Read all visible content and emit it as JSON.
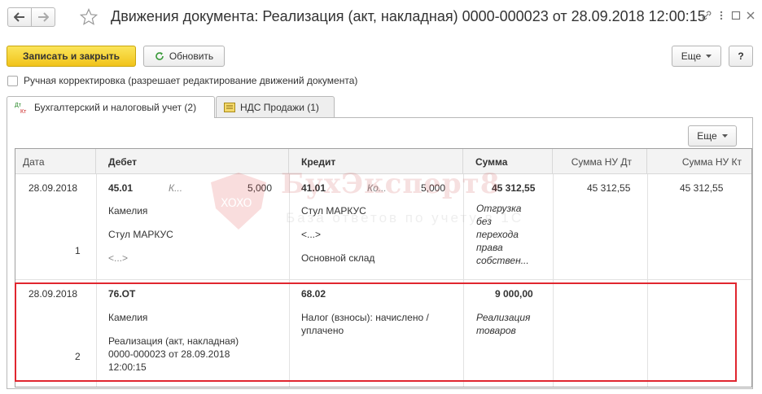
{
  "title": "Движения документа: Реализация (акт, накладная) 0000-000023 от 28.09.2018 12:00:15",
  "toolbar": {
    "save_close": "Записать и закрыть",
    "refresh": "Обновить",
    "more": "Еще",
    "help": "?"
  },
  "manual_correction": "Ручная корректировка (разрешает редактирование движений документа)",
  "tabs": [
    {
      "label": "Бухгалтерский и налоговый учет (2)",
      "icon": "debit-credit-icon"
    },
    {
      "label": "НДС Продажи (1)",
      "icon": "register-icon"
    }
  ],
  "tab_icon_text": {
    "top": "Дт",
    "bottom": "Кт"
  },
  "grid_more": "Еще",
  "columns": {
    "date": "Дата",
    "debit": "Дебет",
    "credit": "Кредит",
    "sum": "Сумма",
    "sum_nu_dt": "Сумма НУ Дт",
    "sum_nu_kt": "Сумма НУ Кт"
  },
  "rows": [
    {
      "date": "28.09.2018",
      "num": "1",
      "debit_account": "45.01",
      "debit_qty_label": "К...",
      "debit_qty": "5,000",
      "debit_sub1": "Камелия",
      "debit_sub2": "Стул МАРКУС",
      "debit_sub3": "<...>",
      "credit_account": "41.01",
      "credit_qty_label": "Ко...",
      "credit_qty": "5,000",
      "credit_sub1": "Стул МАРКУС",
      "credit_sub2": "<...>",
      "credit_sub3": "Основной склад",
      "sum": "45 312,55",
      "content": [
        "Отгрузка",
        "без",
        "перехода",
        "права",
        "собствен..."
      ],
      "sum_nu_dt": "45 312,55",
      "sum_nu_kt": "45 312,55"
    },
    {
      "date": "28.09.2018",
      "num": "2",
      "debit_account": "76.ОТ",
      "debit_sub1": "Камелия",
      "debit_sub2": [
        "Реализация (акт, накладная)",
        "0000-000023 от 28.09.2018",
        "12:00:15"
      ],
      "credit_account": "68.02",
      "credit_sub1": [
        "Налог (взносы): начислено /",
        "уплачено"
      ],
      "sum": "9 000,00",
      "content": [
        "Реализация",
        "товаров"
      ]
    }
  ],
  "watermark": {
    "title": "БухЭксперт8",
    "subtitle": "База ответов по учету в 1С",
    "shield_text": "XOXO"
  },
  "colors": {
    "primary_button": "#f5cd26",
    "highlight": "#e0262f",
    "refresh_icon": "#3a9a3a"
  }
}
